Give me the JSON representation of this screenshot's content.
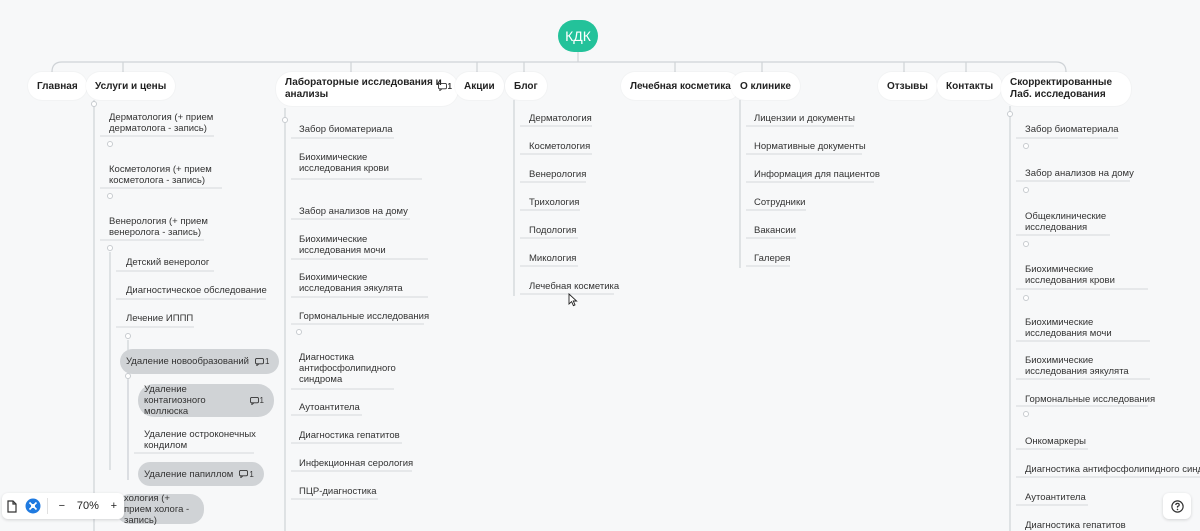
{
  "root": "КДК",
  "branches": {
    "main": "Главная",
    "services": "Услуги и цены",
    "lab": "Лабораторные исследования и анализы",
    "promo": "Акции",
    "blog": "Блог",
    "cosmetics": "Лечебная косметика",
    "about": "О клинике",
    "reviews": "Отзывы",
    "contacts": "Контакты",
    "lab2": "Скорректированные Лаб. исследования"
  },
  "comment_count": "1",
  "services_items": {
    "derm": "Дерматология (+ прием дерматолога - запись)",
    "cosm": "Косметология  (+ прием косметолога - запись)",
    "ven": "Венерология (+ прием венеролога - запись)",
    "kids": "Детский венеролог",
    "diag": "Диагностическое обследование",
    "ippp": "Лечение ИППП",
    "removal": "Удаление новообразований",
    "molluscum": "Удаление контагиозного моллюска",
    "condyloma": "Удаление остроконечных кондилом",
    "papilloma": "Удаление папиллом",
    "next": "хология  (+ прием холога - запись)"
  },
  "lab_items": [
    "Забор биоматериала",
    "Биохимические исследования крови",
    "Забор анализов на дому",
    "Биохимические исследования мочи",
    "Биохимические исследования эякулята",
    "Гормональные исследования",
    "Диагностика антифосфолипидного синдрома",
    "Аутоантитела",
    "Диагностика гепатитов",
    "Инфекционная серология",
    "ПЦР-диагностика"
  ],
  "blog_items": [
    "Дерматология",
    "Косметология",
    "Венерология",
    "Трихология",
    "Подология",
    "Микология",
    "Лечебная косметика"
  ],
  "about_items": [
    "Лицензии и документы",
    "Нормативные документы",
    "Информация для пациентов",
    "Сотрудники",
    "Вакансии",
    "Галерея"
  ],
  "lab2_items": [
    "Забор биоматериала",
    "Забор анализов на дому",
    "Общеклинические исследования",
    "Биохимические исследования крови",
    "Биохимические исследования мочи",
    "Биохимические исследования эякулята",
    "Гормональные исследования",
    "Онкомаркеры",
    "Диагностика антифосфолипидного синд",
    "Аутоантитела",
    "Диагностика гепатитов"
  ],
  "toolbar": {
    "zoom": "70%",
    "minus": "−",
    "plus": "+"
  },
  "colors": {
    "root": "#23c29a",
    "pill": "#d0d3d6",
    "line": "#cfd3d7"
  }
}
